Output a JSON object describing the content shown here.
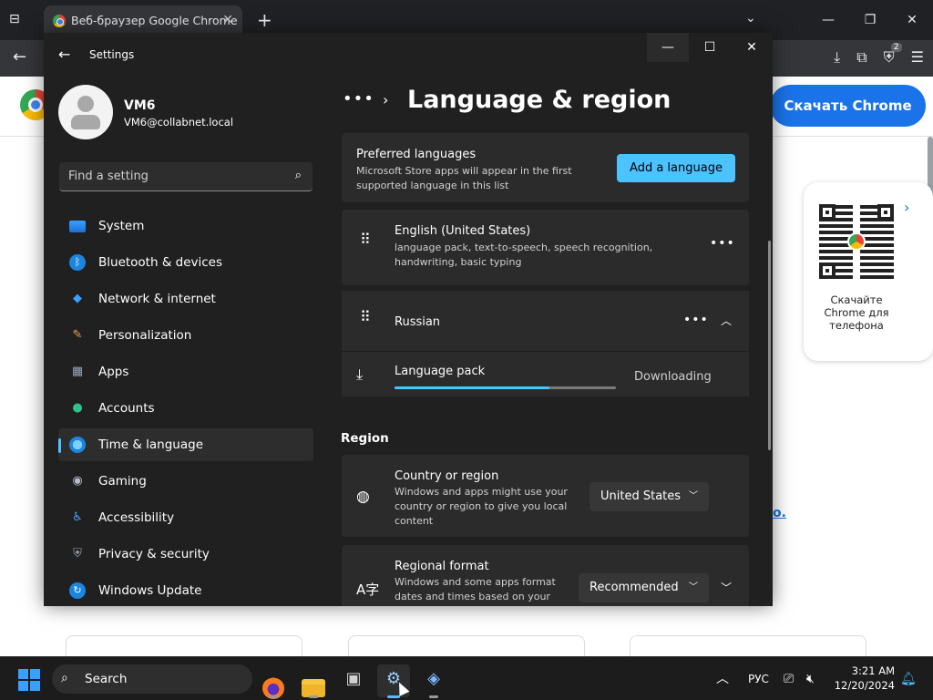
{
  "browser": {
    "tab_title": "Веб-браузер Google Chrome",
    "extension_badge": "2",
    "download_button": "Скачать Chrome",
    "qr_caption": "Скачайте Chrome для телефона",
    "link_fragment": "о."
  },
  "settings": {
    "app_title": "Settings",
    "user": {
      "name": "VM6",
      "email": "VM6@collabnet.local"
    },
    "search_placeholder": "Find a setting",
    "nav": [
      {
        "label": "System",
        "icon": "monitor-icon"
      },
      {
        "label": "Bluetooth & devices",
        "icon": "bluetooth-icon"
      },
      {
        "label": "Network & internet",
        "icon": "wifi-icon"
      },
      {
        "label": "Personalization",
        "icon": "brush-icon"
      },
      {
        "label": "Apps",
        "icon": "apps-icon"
      },
      {
        "label": "Accounts",
        "icon": "person-icon"
      },
      {
        "label": "Time & language",
        "icon": "globe-clock-icon",
        "active": true
      },
      {
        "label": "Gaming",
        "icon": "gamepad-icon"
      },
      {
        "label": "Accessibility",
        "icon": "accessibility-icon"
      },
      {
        "label": "Privacy & security",
        "icon": "shield-icon"
      },
      {
        "label": "Windows Update",
        "icon": "update-icon"
      }
    ],
    "breadcrumb_more": "•••",
    "page_title": "Language & region",
    "preferred": {
      "title": "Preferred languages",
      "desc": "Microsoft Store apps will appear in the first supported language in this list",
      "add_button": "Add a language"
    },
    "languages": [
      {
        "name": "English (United States)",
        "desc": "language pack, text-to-speech, speech recognition, handwriting, basic typing"
      },
      {
        "name": "Russian"
      }
    ],
    "download": {
      "label": "Language pack",
      "status": "Downloading",
      "progress": 0.7
    },
    "region_heading": "Region",
    "country": {
      "title": "Country or region",
      "desc": "Windows and apps might use your country or region to give you local content",
      "value": "United States"
    },
    "format": {
      "title": "Regional format",
      "desc": "Windows and some apps format dates and times based on your",
      "value": "Recommended"
    }
  },
  "taskbar": {
    "search_label": "Search",
    "lang": "РУС",
    "time": "3:21 AM",
    "date": "12/20/2024"
  },
  "colors": {
    "accent": "#4cc2ff",
    "chrome_blue": "#1a73e8"
  }
}
